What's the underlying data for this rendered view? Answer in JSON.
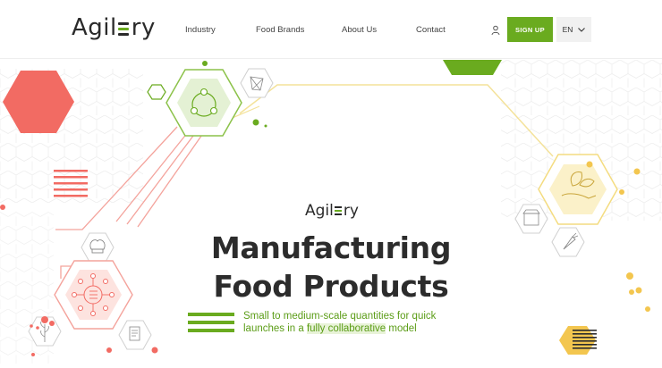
{
  "header": {
    "logo": {
      "pre": "Agil",
      "post": "ry"
    },
    "nav": [
      "Industry",
      "Food Brands",
      "About Us",
      "Contact"
    ],
    "signup_label": "SIGN UP",
    "language": "EN"
  },
  "hero": {
    "logo": {
      "pre": "Agil",
      "post": "ry"
    },
    "headline_line1": "Manufacturing",
    "headline_line2": "Food Products",
    "tagline_line1": "Small to medium-scale quantities for quick",
    "tagline_line2_pre": "launches in a ",
    "tagline_highlight": "fully collaborative",
    "tagline_line2_post": " model"
  },
  "colors": {
    "brand_green": "#6aab1f",
    "coral": "#f26b63",
    "gold": "#f3c64f"
  },
  "icons": [
    "user-icon",
    "chevron-down-icon",
    "team-hexagon-icon",
    "network-hexagon-icon",
    "hand-leaf-icon",
    "store-icon",
    "chef-hat-icon",
    "document-icon",
    "carrot-icon",
    "grain-icon"
  ]
}
